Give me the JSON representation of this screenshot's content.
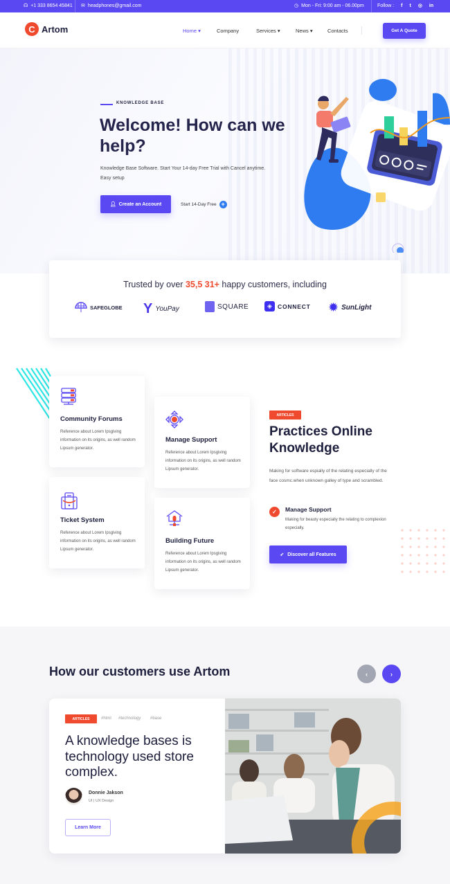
{
  "topbar": {
    "phone": "+1 333 8654 45841",
    "email": "headphones@gmail.com",
    "hours": "Mon - Fri: 9:00 am - 06.00pm",
    "follow_label": "Follow :",
    "social": [
      {
        "icon": "facebook-icon",
        "glyph": "f"
      },
      {
        "icon": "twitter-icon",
        "glyph": "t"
      },
      {
        "icon": "dribbble-icon",
        "glyph": "◎"
      },
      {
        "icon": "linkedin-icon",
        "glyph": "in"
      }
    ]
  },
  "header": {
    "logo_letter": "C",
    "logo_text": "Artom",
    "nav": [
      {
        "label": "Home ▾",
        "active": true
      },
      {
        "label": "Company",
        "active": false
      },
      {
        "label": "Services ▾",
        "active": false
      },
      {
        "label": "News ▾",
        "active": false
      },
      {
        "label": "Contacts",
        "active": false
      }
    ],
    "cta": "Get A Quote"
  },
  "hero": {
    "eyebrow": "KNOWLEDGE BASE",
    "title": "Welcome! How can we help?",
    "subtitle": "Knowledge Base Software. Start Your 14-day Free Trial with Cancel anytime. Easy setup",
    "primary_button": "Create an Account",
    "secondary_link": "Start 14-Day Free",
    "plus_glyph": "+"
  },
  "trusted": {
    "prefix": "Trusted by over ",
    "highlight": "35,5 31+",
    "suffix": " happy customers, including",
    "brands": [
      "SAFEGLOBE",
      "YouPay",
      "SQUARE",
      "CONNECT",
      "SunLight"
    ]
  },
  "features": {
    "cards": [
      {
        "title": "Community Forums",
        "text": "Reference about Lorem Ipsgiving information on its origins, as well random Lipsum generator."
      },
      {
        "title": "Manage Support",
        "text": "Reference about Lorem Ipsgiving information on its origins, as well random Lipsum generator."
      },
      {
        "title": "Ticket System",
        "text": "Reference about Lorem Ipsgiving information on its origins, as well random Lipsum generator."
      },
      {
        "title": "Building Future",
        "text": "Reference about Lorem Ipsgiving information on its origins, as well random Lipsum generator."
      }
    ],
    "badge": "ARTICLES",
    "title": "Practices Online Knowledge",
    "text": "Making for software espially of the relating especially of the face cosmc.when unknown galley of type and scrambled.",
    "check_item": {
      "title": "Manage Support",
      "text": "Making for beauty especially the relating to complexion especially."
    },
    "button": "Discover all Features"
  },
  "customers": {
    "title": "How our customers use Artom",
    "prev": "‹",
    "next": "›",
    "story": {
      "badge": "ARTICLES",
      "tags": [
        "#html",
        "#technology",
        "#base"
      ],
      "title": "A knowledge bases is technology used store complex.",
      "author": "Donnie Jakson",
      "role": "UI | UX Design",
      "button": "Learn More"
    }
  },
  "colors": {
    "primary": "#5a49f2",
    "accent": "#f04a2e",
    "dark": "#1c1e3c",
    "link_blue": "#2f7cf0"
  }
}
